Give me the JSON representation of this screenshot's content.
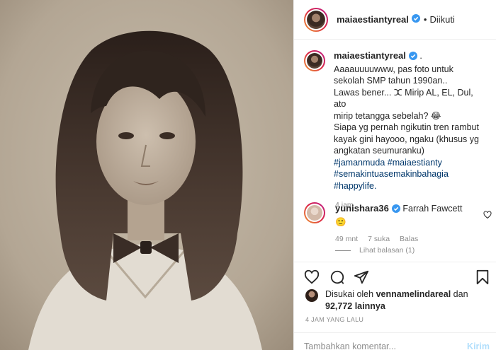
{
  "post": {
    "username": "maiaestiantyreal",
    "follow_status": "Diikuti",
    "header_dot": "•"
  },
  "caption": {
    "username": "maiaestiantyreal",
    "suffix": ".",
    "lines": [
      "Aaaauuuuwww, pas foto untuk",
      "sekolah SMP tahun 1990an..",
      "Lawas bener... ⵋ Mirip AL, EL, Dul, ato",
      "mirip tetangga sebelah? 😂",
      "Siapa yg pernah ngikutin tren rambut",
      "kayak gini hayooo, ngaku (khusus yg",
      "angkatan seumuranku)"
    ],
    "hashtags": [
      "#jamanmuda",
      "#maiaestianty",
      "#semakintuasemakinbahagia",
      "#happylife."
    ],
    "time": "4 jam"
  },
  "comment": {
    "username": "yunishara36",
    "text": "Farrah Fawcett",
    "emoji": "🙂",
    "time": "49 mnt",
    "likes": "7 suka",
    "reply": "Balas",
    "view_replies": "Lihat balasan (1)"
  },
  "likes": {
    "prefix": "Disukai oleh",
    "user": "vennamelindareal",
    "connector": "dan",
    "count": "92,772 lainnya"
  },
  "timestamp": "4 JAM YANG LALU",
  "add_comment": {
    "placeholder": "Tambahkan komentar...",
    "post_label": "Kirim"
  },
  "icons": {
    "verified": "verified-badge-icon",
    "heart": "heart-icon",
    "comment": "comment-icon",
    "share": "share-icon",
    "save": "bookmark-icon"
  },
  "colors": {
    "verified": "#3897f0",
    "hashtag": "#00376b",
    "muted": "#8e8e8e",
    "post_button": "#b2dffc"
  }
}
